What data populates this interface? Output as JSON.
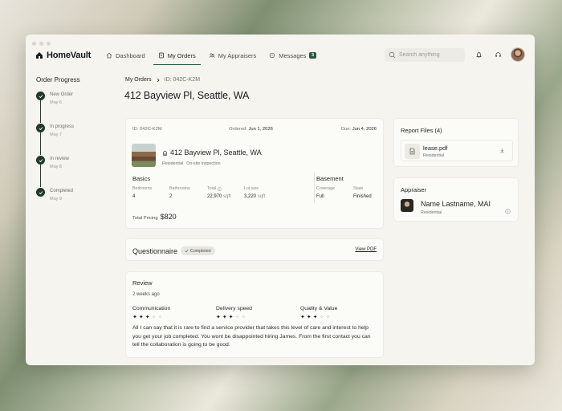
{
  "app": {
    "logo_text": "HomeVault"
  },
  "nav": {
    "items": [
      {
        "label": "Dashboard",
        "icon": "home-icon"
      },
      {
        "label": "My Orders",
        "icon": "orders-icon"
      },
      {
        "label": "My Appraisers",
        "icon": "users-icon"
      },
      {
        "label": "Messages",
        "icon": "chat-icon",
        "badge": "3"
      }
    ],
    "active": "My Orders",
    "accent": "#2a5a3f"
  },
  "search": {
    "placeholder": "Search anything"
  },
  "progress": {
    "title": "Order Progress",
    "steps": [
      {
        "label": "New Order",
        "date": "May 6"
      },
      {
        "label": "In progress",
        "date": "May 7"
      },
      {
        "label": "In review",
        "date": "May 8"
      },
      {
        "label": "Completed",
        "date": "May 9"
      }
    ]
  },
  "breadcrumb": {
    "link": "My Orders",
    "current": "ID: 042C-K2M"
  },
  "page": {
    "title": "412 Bayview Pl, Seattle, WA"
  },
  "order": {
    "id_label": "ID: 042C-K2M",
    "ordered_label": "Ordered:",
    "ordered_value": "Jun 1, 2026",
    "due_label": "Due:",
    "due_value": "Jun 4, 2026",
    "property_name": "412 Bayview Pl, Seattle, WA",
    "tags": [
      "Residential",
      "On-site inspection"
    ],
    "basics_title": "Basics",
    "basics": [
      {
        "label": "Bedrooms",
        "value": "4",
        "unit": ""
      },
      {
        "label": "Bathrooms",
        "value": "2",
        "unit": ""
      },
      {
        "label": "Total",
        "value": "22,970",
        "unit": "sqft"
      },
      {
        "label": "Lot size",
        "value": "3,220",
        "unit": "sqft"
      }
    ],
    "basement_title": "Basement",
    "basement": [
      {
        "label": "Coverage",
        "value": "Full"
      },
      {
        "label": "State",
        "value": "Finished"
      }
    ],
    "total_label": "Total Pricing",
    "total_value": "$820"
  },
  "questionnaire": {
    "title": "Questionnaire",
    "status": "Completed",
    "link": "View PDF"
  },
  "review": {
    "title": "Review",
    "time": "2 weeks ago",
    "ratings": [
      {
        "label": "Communication",
        "score": 3,
        "max": 5
      },
      {
        "label": "Delivery speed",
        "score": 3,
        "max": 5
      },
      {
        "label": "Quality & Value",
        "score": 3,
        "max": 5
      }
    ],
    "text": "All I can say that it is rare to find a service provider that takes this level of care and interest to help you get your job completed. You wont be disappointed hiring James. From the first contact  you can tell the collaboration is going to be good."
  },
  "files": {
    "title": "Report Files (4)",
    "items": [
      {
        "name": "lease.pdf",
        "tag": "Residential"
      }
    ]
  },
  "appraiser": {
    "title": "Appraiser",
    "name": "Name Lastname, MAI",
    "tag": "Residential"
  }
}
